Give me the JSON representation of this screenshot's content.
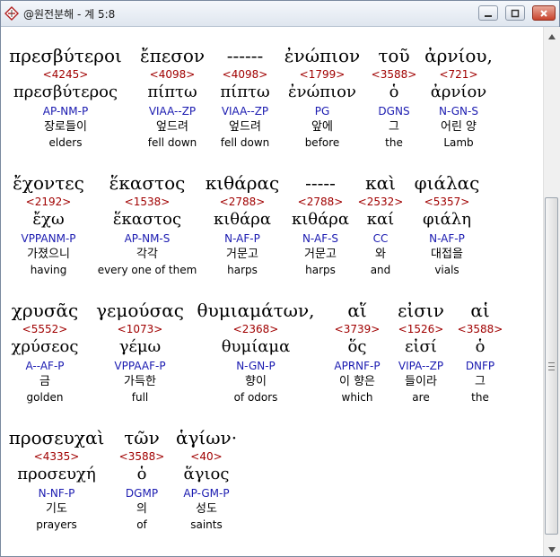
{
  "window": {
    "title": "@원전분해 - 계 5:8",
    "icon": "app-logo-icon",
    "buttons": [
      "minimize-icon",
      "maximize-icon",
      "close-icon"
    ]
  },
  "colors": {
    "strong_number": "#a00000",
    "parsing": "#1a1ab0",
    "text": "#000000"
  },
  "rows": [
    {
      "words": [
        {
          "greek": "πρεσβύτεροι",
          "num": "<4245>",
          "lemma": "πρεσβύτερος",
          "parse": "AP-NM-P",
          "kor": "장로들이",
          "eng": "elders"
        },
        {
          "greek": "ἔπεσον",
          "num": "<4098>",
          "lemma": "πίπτω",
          "parse": "VIAA--ZP",
          "kor": "엎드려",
          "eng": "fell down"
        },
        {
          "greek": "------",
          "num": "<4098>",
          "lemma": "πίπτω",
          "parse": "VIAA--ZP",
          "kor": "엎드려",
          "eng": "fell down"
        },
        {
          "greek": "ἐνώπιον",
          "num": "<1799>",
          "lemma": "ἐνώπιον",
          "parse": "PG",
          "kor": "앞에",
          "eng": "before"
        },
        {
          "greek": "τοῦ",
          "num": "<3588>",
          "lemma": "ὁ",
          "parse": "DGNS",
          "kor": "그",
          "eng": "the"
        },
        {
          "greek": "ἀρνίου,",
          "num": "<721>",
          "lemma": "ἀρνίον",
          "parse": "N-GN-S",
          "kor": "어린 양",
          "eng": "Lamb"
        }
      ]
    },
    {
      "words": [
        {
          "greek": "ἔχοντες",
          "num": "<2192>",
          "lemma": "ἔχω",
          "parse": "VPPANM-P",
          "kor": "가졌으니",
          "eng": "having"
        },
        {
          "greek": "ἕκαστος",
          "num": "<1538>",
          "lemma": "ἕκαστος",
          "parse": "AP-NM-S",
          "kor": "각각",
          "eng": "every one of them"
        },
        {
          "greek": "κιθάρας",
          "num": "<2788>",
          "lemma": "κιθάρα",
          "parse": "N-AF-P",
          "kor": "거문고",
          "eng": "harps"
        },
        {
          "greek": "-----",
          "num": "<2788>",
          "lemma": "κιθάρα",
          "parse": "N-AF-S",
          "kor": "거문고",
          "eng": "harps"
        },
        {
          "greek": "καὶ",
          "num": "<2532>",
          "lemma": "καί",
          "parse": "CC",
          "kor": "와",
          "eng": "and"
        },
        {
          "greek": "φιάλας",
          "num": "<5357>",
          "lemma": "φιάλη",
          "parse": "N-AF-P",
          "kor": "대접을",
          "eng": "vials"
        }
      ]
    },
    {
      "words": [
        {
          "greek": "χρυσᾶς",
          "num": "<5552>",
          "lemma": "χρύσεος",
          "parse": "A--AF-P",
          "kor": "금",
          "eng": "golden"
        },
        {
          "greek": "γεμούσας",
          "num": "<1073>",
          "lemma": "γέμω",
          "parse": "VPPAAF-P",
          "kor": "가득한",
          "eng": "full"
        },
        {
          "greek": "θυμιαμάτων,",
          "num": "<2368>",
          "lemma": "θυμίαμα",
          "parse": "N-GN-P",
          "kor": "향이",
          "eng": "of odors"
        },
        {
          "greek": "αἵ",
          "num": "<3739>",
          "lemma": "ὅς",
          "parse": "APRNF-P",
          "kor": "이 향은",
          "eng": "which"
        },
        {
          "greek": "εἰσιν",
          "num": "<1526>",
          "lemma": "εἰσί",
          "parse": "VIPA--ZP",
          "kor": "들이라",
          "eng": "are"
        },
        {
          "greek": "αἱ",
          "num": "<3588>",
          "lemma": "ὁ",
          "parse": "DNFP",
          "kor": "그",
          "eng": "the"
        }
      ]
    },
    {
      "words": [
        {
          "greek": "προσευχαὶ",
          "num": "<4335>",
          "lemma": "προσευχή",
          "parse": "N-NF-P",
          "kor": "기도",
          "eng": "prayers"
        },
        {
          "greek": "τῶν",
          "num": "<3588>",
          "lemma": "ὁ",
          "parse": "DGMP",
          "kor": "의",
          "eng": "of"
        },
        {
          "greek": "ἁγίων·",
          "num": "<40>",
          "lemma": "ἅγιος",
          "parse": "AP-GM-P",
          "kor": "성도",
          "eng": "saints"
        }
      ]
    }
  ]
}
